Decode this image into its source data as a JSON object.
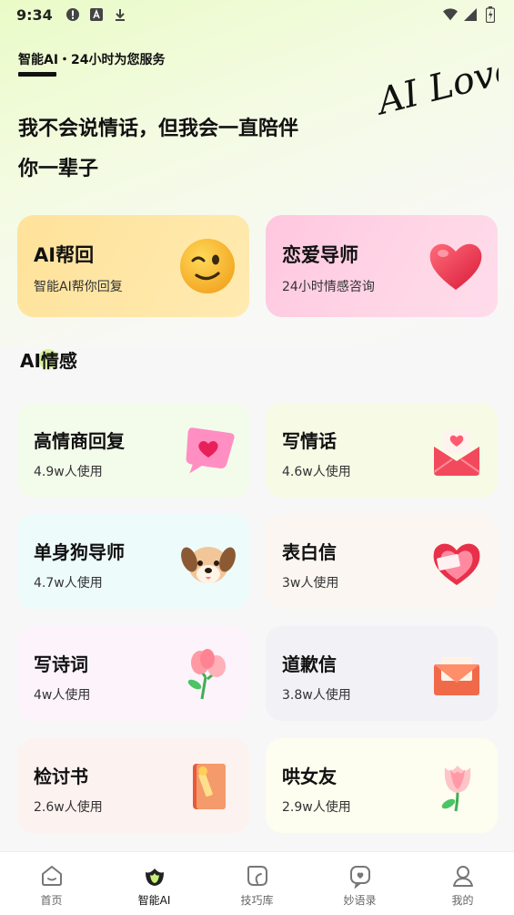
{
  "status_bar": {
    "time": "9:34",
    "icons": [
      "alert-circle-icon",
      "font-a-icon",
      "download-icon"
    ],
    "right_icons": [
      "wifi-icon",
      "signal-icon",
      "battery-icon"
    ]
  },
  "header": {
    "subtitle": "智能AI・24小时为您服务",
    "logo_text": "AI Loves",
    "headline_line1": "我不会说情话，但我会一直陪伴",
    "headline_line2": "你一辈子"
  },
  "feature_cards": [
    {
      "title": "AI帮回",
      "desc": "智能AI帮你回复",
      "icon": "wink-face-icon"
    },
    {
      "title": "恋爱导师",
      "desc": "24小时情感咨询",
      "icon": "heart-icon"
    }
  ],
  "section": {
    "title": "AI情感"
  },
  "tools": [
    {
      "title": "高情商回复",
      "usage": "4.9w人使用",
      "icon": "heart-chat-bubble-icon",
      "bg": "#f3fbea"
    },
    {
      "title": "写情话",
      "usage": "4.6w人使用",
      "icon": "love-envelope-icon",
      "bg": "#f7fbe6"
    },
    {
      "title": "单身狗导师",
      "usage": "4.7w人使用",
      "icon": "dog-face-icon",
      "bg": "#eefbfb"
    },
    {
      "title": "表白信",
      "usage": "3w人使用",
      "icon": "heart-box-icon",
      "bg": "#fbf6f1"
    },
    {
      "title": "写诗词",
      "usage": "4w人使用",
      "icon": "flower-bouquet-icon",
      "bg": "#fcf3fb"
    },
    {
      "title": "道歉信",
      "usage": "3.8w人使用",
      "icon": "apology-envelope-icon",
      "bg": "#f1f1f6"
    },
    {
      "title": "检讨书",
      "usage": "2.6w人使用",
      "icon": "book-pencil-icon",
      "bg": "#fcf2f0"
    },
    {
      "title": "哄女友",
      "usage": "2.9w人使用",
      "icon": "tulip-icon",
      "bg": "#fdfdf0"
    }
  ],
  "tab_bar": {
    "items": [
      {
        "label": "首页",
        "icon": "home-icon"
      },
      {
        "label": "智能AI",
        "icon": "lotus-icon"
      },
      {
        "label": "技巧库",
        "icon": "tips-icon"
      },
      {
        "label": "妙语录",
        "icon": "heart-message-icon"
      },
      {
        "label": "我的",
        "icon": "user-icon"
      }
    ],
    "active_index": 1
  },
  "colors": {
    "accent_green": "#c8f078",
    "ai_card": "#ffe29a",
    "love_card": "#ffc7df"
  }
}
